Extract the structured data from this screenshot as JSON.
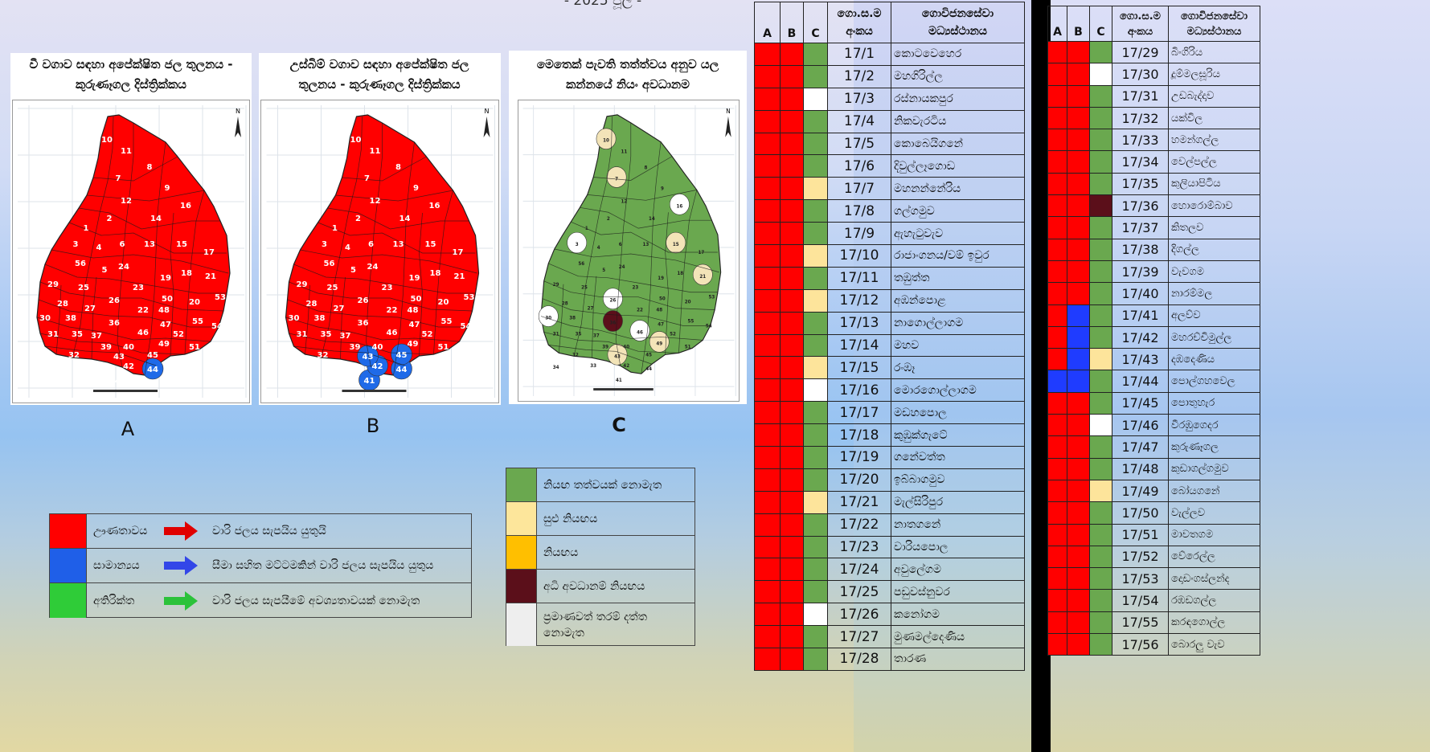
{
  "header": {
    "date": "- 2025 ජූලි -"
  },
  "colors": {
    "red": "#ff0000",
    "blue": "#2a6ef2",
    "green": "#5fa83c",
    "light": "#f4e7bd",
    "brown": "#6b0f17",
    "white": "#ffffff",
    "legend_green": "#2fcc38"
  },
  "maps": [
    {
      "title": "වී වගාව සඳහා අපේක්ෂිත ජල තුලනය - කුරුණෑගල දිස්ත්‍රික්කය",
      "letter": "A",
      "blue_zones": [
        "44"
      ]
    },
    {
      "title": "උස්බිම් වගාව සඳහා අපේක්ෂිත ජල තුලනය - කුරුණෑගල දිස්ත්‍රික්කය",
      "letter": "B",
      "blue_zones": [
        "41",
        "42",
        "43",
        "44",
        "45"
      ]
    },
    {
      "title": "මෙතෙක් පැවති තත්ත්වය අනුව යල කන්නයේ නියං අවධානම",
      "letter": "C"
    }
  ],
  "map_labels": [
    "10",
    "11",
    "8",
    "7",
    "9",
    "12",
    "16",
    "2",
    "14",
    "1",
    "3",
    "4",
    "6",
    "13",
    "15",
    "17",
    "56",
    "5",
    "24",
    "18",
    "21",
    "29",
    "25",
    "23",
    "19",
    "53",
    "28",
    "26",
    "50",
    "20",
    "30",
    "38",
    "27",
    "22",
    "48",
    "55",
    "54",
    "31",
    "35",
    "37",
    "36",
    "46",
    "47",
    "52",
    "39",
    "40",
    "49",
    "51",
    "32",
    "33",
    "43",
    "42",
    "45",
    "34",
    "41",
    "44"
  ],
  "legend1": [
    {
      "label": "ඌණතාවය",
      "color": "#ff0000",
      "arrow": "#e00000",
      "desc": "වාරි ජලය සැපයිය යුතුයි"
    },
    {
      "label": "සාමාන්‍යය",
      "color": "#1f5fe8",
      "arrow": "#3346e8",
      "desc": "සීමා සහිත මට්ටමකින් වාරි ජලය සැපයිය යුතුය"
    },
    {
      "label": "අතිරික්ත",
      "color": "#2fcc38",
      "arrow": "#2bc23a",
      "desc": "වාරි ජලය සැපයීමේ අවශ්‍යතාවයක් නොමැත"
    }
  ],
  "legend2": [
    {
      "color": "#6aa84f",
      "desc": "නියඟ තත්වයක් නොමැත"
    },
    {
      "color": "#fde69b",
      "desc": "සුළු නියඟය"
    },
    {
      "color": "#ffbf00",
      "desc": "නියඟය"
    },
    {
      "color": "#5b0f1a",
      "desc": "අධි අවධානම් නියඟය"
    },
    {
      "color": "#eeeeee",
      "desc": "ප්‍රමාණවත් තරම් දත්ත නොමැත"
    }
  ],
  "table": {
    "headers": {
      "a": "A",
      "b": "B",
      "c": "C",
      "code": "ගො.ස.ම අංකය",
      "name": "ගොවිජනසේවා මධ්‍යස්ථානය"
    },
    "rows_left": [
      {
        "a": "r",
        "b": "r",
        "c": "g",
        "code": "17/1",
        "name": "කොටවෙහෙර"
      },
      {
        "a": "r",
        "b": "r",
        "c": "g",
        "code": "17/2",
        "name": "මහගිරිල්ල"
      },
      {
        "a": "r",
        "b": "r",
        "c": "w",
        "code": "17/3",
        "name": "රස්නායකපුර"
      },
      {
        "a": "r",
        "b": "r",
        "c": "g",
        "code": "17/4",
        "name": "නිකවැරටිය"
      },
      {
        "a": "r",
        "b": "r",
        "c": "g",
        "code": "17/5",
        "name": "කොබෙයිගනේ"
      },
      {
        "a": "r",
        "b": "r",
        "c": "g",
        "code": "17/6",
        "name": "දිවුල්ලෑගොඩ"
      },
      {
        "a": "r",
        "b": "r",
        "c": "y",
        "code": "17/7",
        "name": "මහනන්නේරිය"
      },
      {
        "a": "r",
        "b": "r",
        "c": "g",
        "code": "17/8",
        "name": "ගල්ගමුව"
      },
      {
        "a": "r",
        "b": "r",
        "c": "g",
        "code": "17/9",
        "name": "ඇහැටුවැව"
      },
      {
        "a": "r",
        "b": "r",
        "c": "y",
        "code": "17/10",
        "name": "රාජාංගනය/වම් ඉවුර"
      },
      {
        "a": "r",
        "b": "r",
        "c": "g",
        "code": "17/11",
        "name": "තඹුත්ත"
      },
      {
        "a": "r",
        "b": "r",
        "c": "y",
        "code": "17/12",
        "name": "අඹන්පොළ"
      },
      {
        "a": "r",
        "b": "r",
        "c": "g",
        "code": "17/13",
        "name": "නාගොල්ලාගම"
      },
      {
        "a": "r",
        "b": "r",
        "c": "g",
        "code": "17/14",
        "name": "මහව"
      },
      {
        "a": "r",
        "b": "r",
        "c": "y",
        "code": "17/15",
        "name": "රංඹෑ"
      },
      {
        "a": "r",
        "b": "r",
        "c": "w",
        "code": "17/16",
        "name": "මොරගොල්ලාගම"
      },
      {
        "a": "r",
        "b": "r",
        "c": "g",
        "code": "17/17",
        "name": "මඩහපොල"
      },
      {
        "a": "r",
        "b": "r",
        "c": "g",
        "code": "17/18",
        "name": "කුඹුක්ගැටේ"
      },
      {
        "a": "r",
        "b": "r",
        "c": "g",
        "code": "17/19",
        "name": "ගනේවත්ත"
      },
      {
        "a": "r",
        "b": "r",
        "c": "g",
        "code": "17/20",
        "name": "ඉබ්බාගමුව"
      },
      {
        "a": "r",
        "b": "r",
        "c": "y",
        "code": "17/21",
        "name": "මැල්සිරිපුර"
      },
      {
        "a": "r",
        "b": "r",
        "c": "g",
        "code": "17/22",
        "name": "නාතගනේ"
      },
      {
        "a": "r",
        "b": "r",
        "c": "g",
        "code": "17/23",
        "name": "වාරියපොල"
      },
      {
        "a": "r",
        "b": "r",
        "c": "g",
        "code": "17/24",
        "name": "අවුලේගම"
      },
      {
        "a": "r",
        "b": "r",
        "c": "g",
        "code": "17/25",
        "name": "පඩුවස්නුවර"
      },
      {
        "a": "r",
        "b": "r",
        "c": "w",
        "code": "17/26",
        "name": "කනෝගම"
      },
      {
        "a": "r",
        "b": "r",
        "c": "g",
        "code": "17/27",
        "name": "මුණමල්දෙණිය"
      },
      {
        "a": "r",
        "b": "r",
        "c": "g",
        "code": "17/28",
        "name": "තාරණ"
      }
    ],
    "rows_right": [
      {
        "a": "r",
        "b": "r",
        "c": "g",
        "code": "17/29",
        "name": "බිංගිරිය"
      },
      {
        "a": "r",
        "b": "r",
        "c": "w",
        "code": "17/30",
        "name": "දූම්මලසූරිය"
      },
      {
        "a": "r",
        "b": "r",
        "c": "g",
        "code": "17/31",
        "name": "උඩබැද්දාව"
      },
      {
        "a": "r",
        "b": "r",
        "c": "g",
        "code": "17/32",
        "name": "යක්විල"
      },
      {
        "a": "r",
        "b": "r",
        "c": "g",
        "code": "17/33",
        "name": "හමන්ගල්ල"
      },
      {
        "a": "r",
        "b": "r",
        "c": "g",
        "code": "17/34",
        "name": "වෙල්පල්ල"
      },
      {
        "a": "r",
        "b": "r",
        "c": "g",
        "code": "17/35",
        "name": "කුලියාපිටිය"
      },
      {
        "a": "r",
        "b": "r",
        "c": "m",
        "code": "17/36",
        "name": "හොරොම්බාව"
      },
      {
        "a": "r",
        "b": "r",
        "c": "g",
        "code": "17/37",
        "name": "කිතලව"
      },
      {
        "a": "r",
        "b": "r",
        "c": "g",
        "code": "17/38",
        "name": "දිගල්ල"
      },
      {
        "a": "r",
        "b": "r",
        "c": "g",
        "code": "17/39",
        "name": "වැවගම"
      },
      {
        "a": "r",
        "b": "r",
        "c": "g",
        "code": "17/40",
        "name": "නාරම්මල"
      },
      {
        "a": "r",
        "b": "b",
        "c": "g",
        "code": "17/41",
        "name": "අලව්ව"
      },
      {
        "a": "r",
        "b": "b",
        "c": "g",
        "code": "17/42",
        "name": "මහරච්චිමුල්ල"
      },
      {
        "a": "r",
        "b": "b",
        "c": "y",
        "code": "17/43",
        "name": "දඹදෙණිය"
      },
      {
        "a": "b",
        "b": "b",
        "c": "g",
        "code": "17/44",
        "name": "පොල්ගහවෙල"
      },
      {
        "a": "r",
        "b": "r",
        "c": "g",
        "code": "17/45",
        "name": "පොතුහැර"
      },
      {
        "a": "r",
        "b": "r",
        "c": "w",
        "code": "17/46",
        "name": "වීරඹුගෙදර"
      },
      {
        "a": "r",
        "b": "r",
        "c": "g",
        "code": "17/47",
        "name": "කුරුණෑගල"
      },
      {
        "a": "r",
        "b": "r",
        "c": "g",
        "code": "17/48",
        "name": "කුඩාගල්ගමුව"
      },
      {
        "a": "r",
        "b": "r",
        "c": "y",
        "code": "17/49",
        "name": "බෝයගනේ"
      },
      {
        "a": "r",
        "b": "r",
        "c": "g",
        "code": "17/50",
        "name": "වැල්ලව"
      },
      {
        "a": "r",
        "b": "r",
        "c": "g",
        "code": "17/51",
        "name": "මාවතගම"
      },
      {
        "a": "r",
        "b": "r",
        "c": "g",
        "code": "17/52",
        "name": "වේරෙල්ල"
      },
      {
        "a": "r",
        "b": "r",
        "c": "g",
        "code": "17/53",
        "name": "දොඩංගස්ලන්ද"
      },
      {
        "a": "r",
        "b": "r",
        "c": "g",
        "code": "17/54",
        "name": "රඹඩගල්ල"
      },
      {
        "a": "r",
        "b": "r",
        "c": "g",
        "code": "17/55",
        "name": "කරඳගොල්ල"
      },
      {
        "a": "r",
        "b": "r",
        "c": "g",
        "code": "17/56",
        "name": "බොරලු වැව"
      }
    ]
  }
}
